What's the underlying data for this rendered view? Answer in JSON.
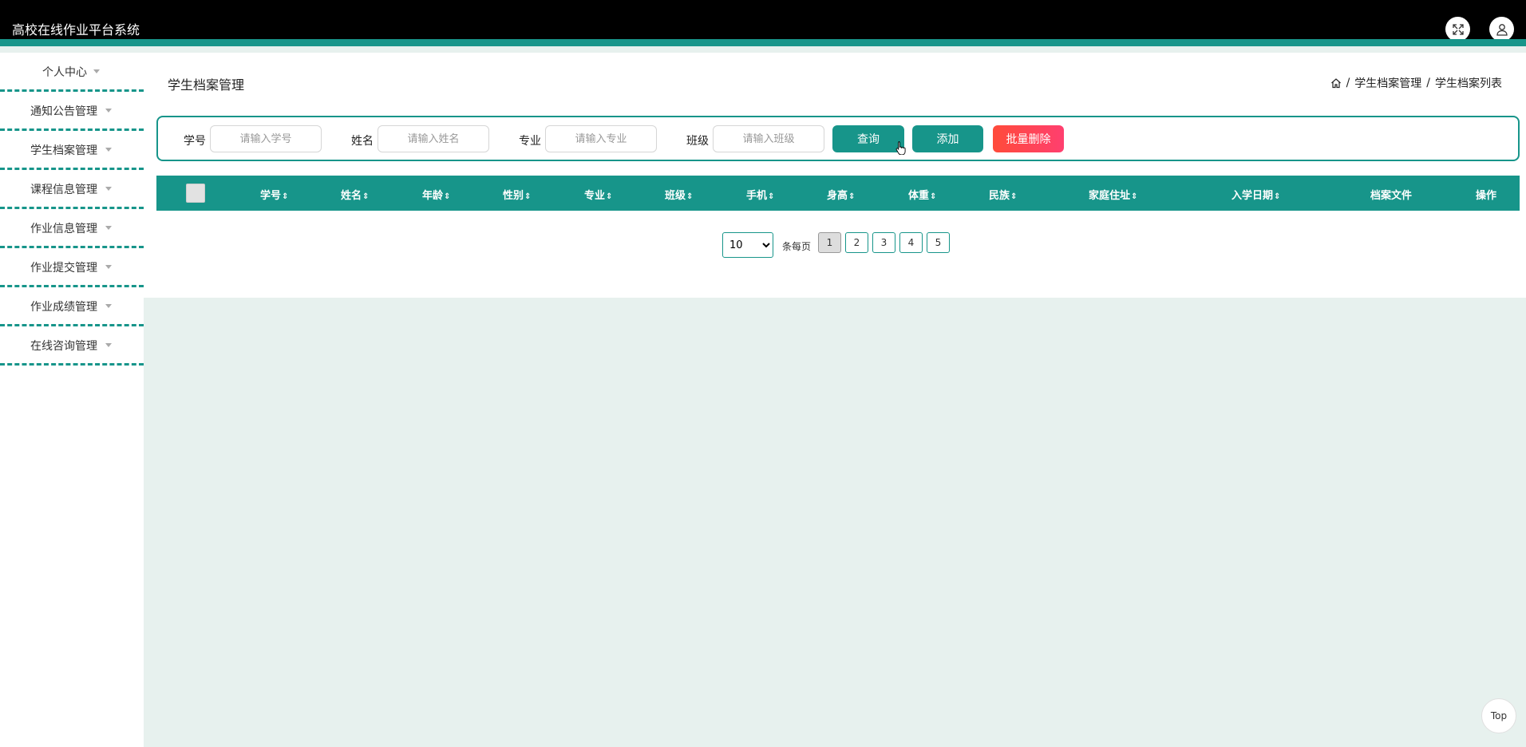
{
  "app": {
    "title": "高校在线作业平台系统"
  },
  "header": {
    "fullscreen_icon": "fullscreen-icon",
    "user_icon": "user-icon"
  },
  "sidebar": {
    "items": [
      {
        "label": "个人中心"
      },
      {
        "label": "通知公告管理"
      },
      {
        "label": "学生档案管理"
      },
      {
        "label": "课程信息管理"
      },
      {
        "label": "作业信息管理"
      },
      {
        "label": "作业提交管理"
      },
      {
        "label": "作业成绩管理"
      },
      {
        "label": "在线咨询管理"
      }
    ]
  },
  "page": {
    "title": "学生档案管理",
    "breadcrumb": [
      "学生档案管理",
      "学生档案列表"
    ]
  },
  "search": {
    "fields": [
      {
        "label": "学号",
        "placeholder": "请输入学号"
      },
      {
        "label": "姓名",
        "placeholder": "请输入姓名"
      },
      {
        "label": "专业",
        "placeholder": "请输入专业"
      },
      {
        "label": "班级",
        "placeholder": "请输入班级"
      }
    ],
    "query_label": "查询",
    "add_label": "添加",
    "batch_delete_label": "批量删除"
  },
  "table": {
    "columns": [
      "学号",
      "姓名",
      "年龄",
      "性别",
      "专业",
      "班级",
      "手机",
      "身高",
      "体重",
      "民族",
      "家庭住址",
      "入学日期",
      "档案文件",
      "操作"
    ],
    "sort_glyph": "⇕",
    "rows": []
  },
  "pagination": {
    "page_size": "10",
    "per_page_label": "条每页",
    "pages": [
      "1",
      "2",
      "3",
      "4",
      "5"
    ],
    "current": "1"
  },
  "back_to_top": "Top",
  "colors": {
    "accent": "#17958a",
    "danger": "#ff4b3a",
    "background": "#e7f1ee"
  }
}
